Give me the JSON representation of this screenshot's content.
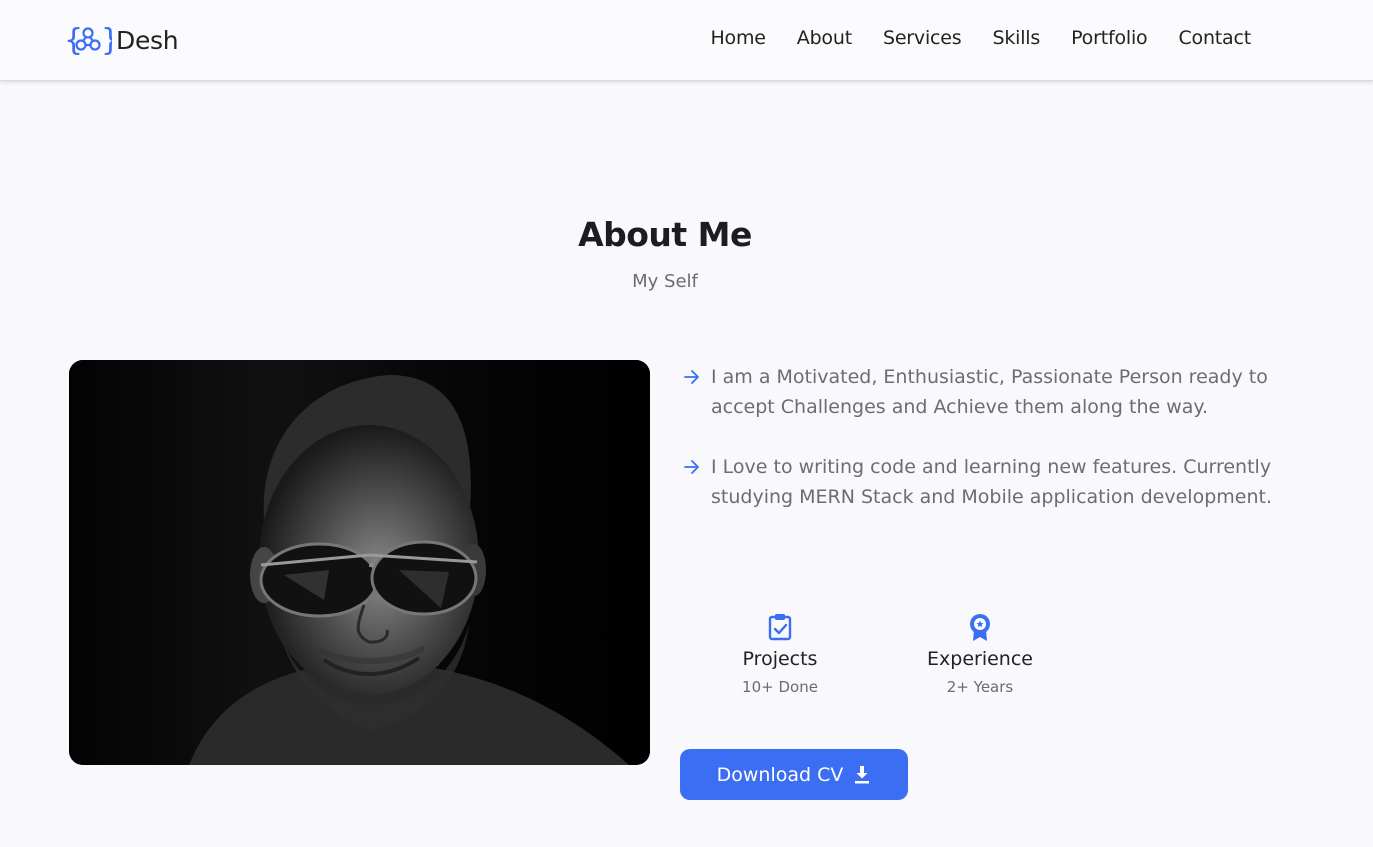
{
  "brand": {
    "name": "Desh",
    "icon": "code-bracket-network-icon",
    "accent": "#3b6ef2"
  },
  "nav": {
    "items": [
      "Home",
      "About",
      "Services",
      "Skills",
      "Portfolio",
      "Contact"
    ]
  },
  "about": {
    "title": "About Me",
    "subtitle": "My Self",
    "photo_icon": "profile-photo",
    "points": [
      "I am a Motivated, Enthusiastic, Passionate Person ready to accept Challenges and Achieve them along the way.",
      "I Love to writing code and learning new features. Currently studying MERN Stack and Mobile application development."
    ],
    "stats": [
      {
        "icon": "clipboard-check-icon",
        "title": "Projects",
        "value": "10+ Done"
      },
      {
        "icon": "award-badge-icon",
        "title": "Experience",
        "value": "2+ Years"
      }
    ],
    "download_label": "Download CV",
    "download_icon": "download-icon"
  }
}
